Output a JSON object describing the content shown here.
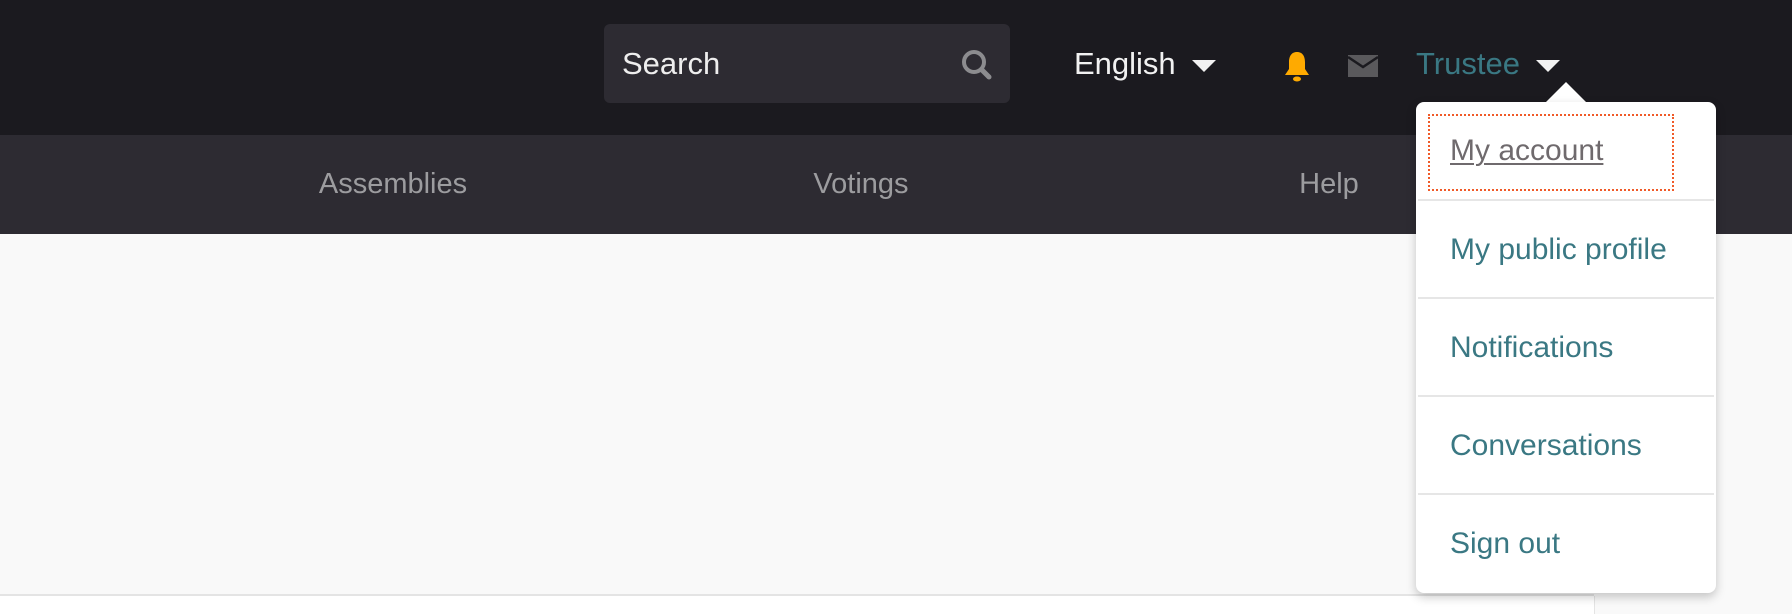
{
  "header": {
    "search": {
      "placeholder": "Search",
      "value": "",
      "icon": "search-icon"
    },
    "language": {
      "label": "English",
      "icon": "chevron-down-icon"
    },
    "notifications_icon": "bell-icon",
    "notifications_color": "#ffaa00",
    "messages_icon": "envelope-icon",
    "user": {
      "label": "Trustee",
      "icon": "chevron-down-icon",
      "color": "#3a7883"
    }
  },
  "nav": {
    "items": [
      {
        "label": "Assemblies"
      },
      {
        "label": "Votings"
      },
      {
        "label": "Help"
      }
    ]
  },
  "user_menu": {
    "items": [
      {
        "label": "My account",
        "focused": true
      },
      {
        "label": "My public profile"
      },
      {
        "label": "Notifications"
      },
      {
        "label": "Conversations"
      },
      {
        "label": "Sign out"
      }
    ],
    "focus_color": "#f05a28"
  }
}
